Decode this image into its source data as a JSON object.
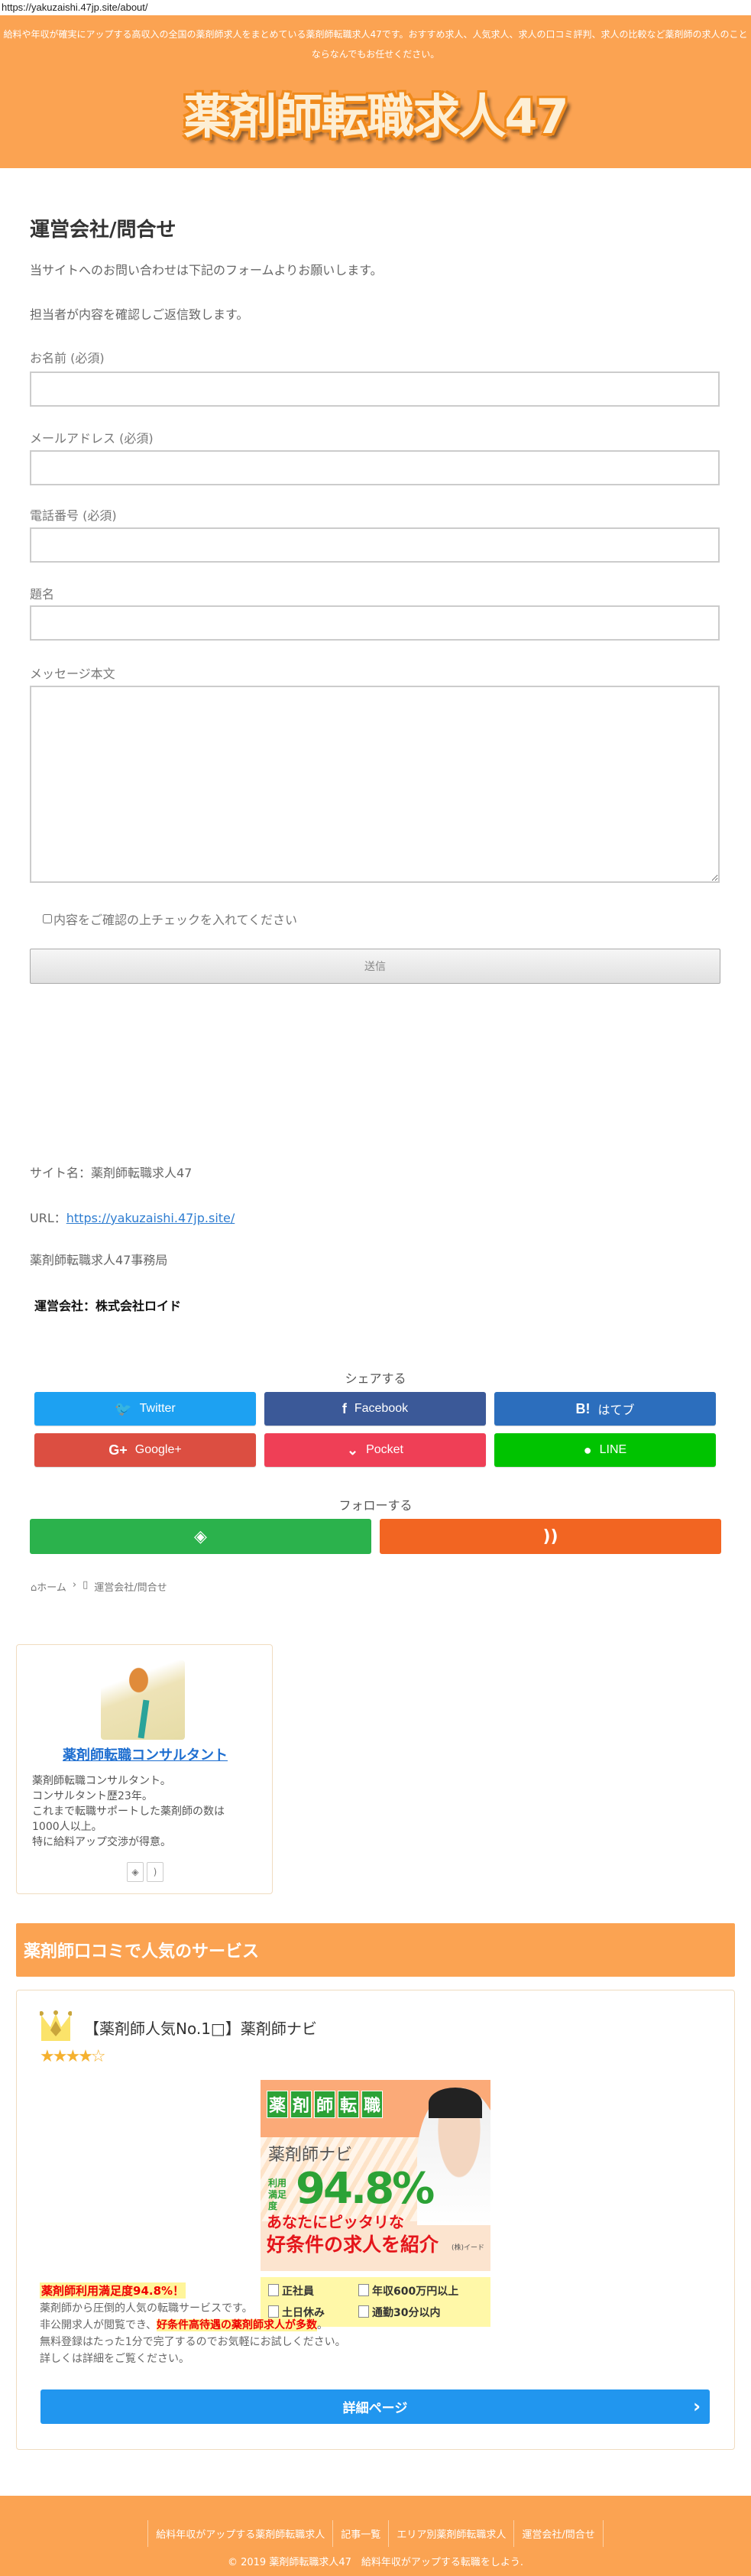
{
  "browser": {
    "url": "https://yakuzaishi.47jp.site/about/"
  },
  "header": {
    "tagline": "給料や年収が確実にアップする高収入の全国の薬剤師求人をまとめている薬剤師転職求人47です。おすすめ求人、人気求人、求人の口コミ評判、求人の比較など薬剤師の求人のことならなんでもお任せください。",
    "logo_text": "薬剤師転職求人47"
  },
  "page": {
    "title": "運営会社/問合せ",
    "intro": [
      "当サイトへのお問い合わせは下記のフォームよりお願いします。",
      "担当者が内容を確認しご返信致します。"
    ]
  },
  "form": {
    "name_label": "お名前 (必須)",
    "email_label": "メールアドレス (必須)",
    "phone_label": "電話番号 (必須)",
    "subject_label": "題名",
    "message_label": "メッセージ本文",
    "name_value": "",
    "email_value": "",
    "phone_value": "",
    "subject_value": "",
    "message_value": "",
    "confirm_label": "内容をご確認の上チェックを入れてください",
    "submit_label": "送信"
  },
  "info": {
    "site_name": "サイト名：薬剤師転職求人47",
    "url_prefix": "URL：",
    "url_link": "https://yakuzaishi.47jp.site/",
    "office": "薬剤師転職求人47事務局",
    "company": "運営会社：株式会社ロイド"
  },
  "share": {
    "title": "シェアする",
    "buttons": [
      {
        "label": "Twitter",
        "icon": "twitter-icon",
        "color": "#1da1f2"
      },
      {
        "label": "Facebook",
        "icon": "facebook-icon",
        "color": "#3b5998"
      },
      {
        "label": "はてブ",
        "icon": "hatena-bookmark-icon",
        "color": "#2c6ebd"
      },
      {
        "label": "Google+",
        "icon": "google-plus-icon",
        "color": "#dc4e41"
      },
      {
        "label": "Pocket",
        "icon": "pocket-icon",
        "color": "#ef3f56"
      },
      {
        "label": "LINE",
        "icon": "line-icon",
        "color": "#00c300"
      }
    ]
  },
  "follow": {
    "title": "フォローする",
    "buttons": [
      {
        "icon": "feedly-icon",
        "color": "#2bb24c"
      },
      {
        "icon": "rss-icon",
        "color": "#f26522"
      }
    ]
  },
  "breadcrumb": {
    "home": "ホーム",
    "current": "運営会社/問合せ"
  },
  "author": {
    "name": "薬剤師転職コンサルタント",
    "bio": [
      "薬剤師転職コンサルタント。",
      "コンサルタント歴23年。",
      "これまで転職サポートした薬剤師の数は",
      "1000人以上。",
      "特に給料アップ交渉が得意。"
    ]
  },
  "services": {
    "heading": "薬剤師口コミで人気のサービス",
    "item": {
      "title": "【薬剤師人気No.1□】薬剤師ナビ",
      "rating": 4.5,
      "stars": "★★★★☆",
      "banner": {
        "tags": [
          "薬",
          "剤",
          "師",
          "転",
          "職"
        ],
        "brand": "薬剤師ナビ",
        "util_label": "利用満足度",
        "percent": "94.8%",
        "line1": "あなたにピッタリな",
        "line2": "好条件の求人を紹介",
        "corp": "(株)イード",
        "checks": [
          "正社員",
          "年収600万円以上",
          "土日休み",
          "通勤30分以内"
        ]
      },
      "highlight": "薬剤師利用満足度94.8%！",
      "body1": "薬剤師から圧倒的人気の転職サービスです。",
      "body2_prefix": "非公開求人が閲覧でき、",
      "body2_mark": "好条件高待遇の薬剤師求人が多数",
      "body2_suffix": "。",
      "body3": "無料登録はたった1分で完了するのでお気軽にお試しください。",
      "body4": "詳しくは詳細をご覧ください。",
      "button": "詳細ページ"
    }
  },
  "footer": {
    "links": [
      "給料年収がアップする薬剤師転職求人",
      "記事一覧",
      "エリア別薬剤師転職求人",
      "運営会社/問合せ"
    ],
    "copyright": "© 2019 薬剤師転職求人47　給料年収がアップする転職をしよう."
  },
  "colors": {
    "accent": "#fba352",
    "link": "#2e7dd1",
    "button_blue": "#2196ef"
  }
}
